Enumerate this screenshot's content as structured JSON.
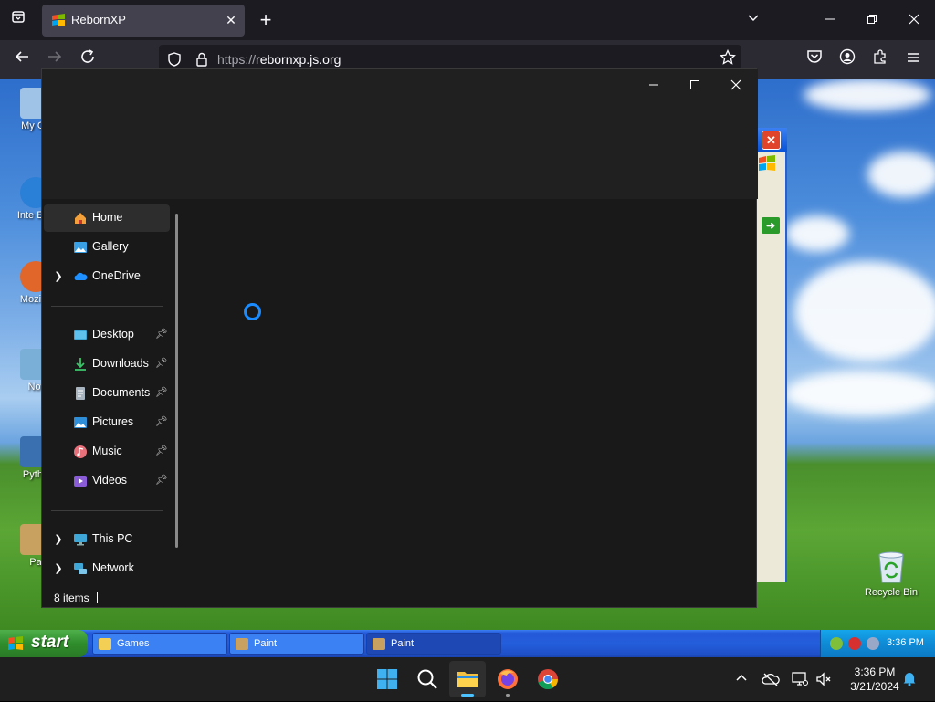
{
  "browser": {
    "tab_title": "RebornXP",
    "url_scheme": "https://",
    "url_host": "rebornxp.js.org"
  },
  "desktop": {
    "icons": [
      "My Co",
      "Inte Exp",
      "Mozilla",
      "Not",
      "Pytho",
      "Pa"
    ],
    "recycle_bin": "Recycle Bin"
  },
  "explorer": {
    "nav": {
      "home": "Home",
      "gallery": "Gallery",
      "onedrive": "OneDrive",
      "desktop": "Desktop",
      "downloads": "Downloads",
      "documents": "Documents",
      "pictures": "Pictures",
      "music": "Music",
      "videos": "Videos",
      "this_pc": "This PC",
      "network": "Network"
    },
    "status": "8 items"
  },
  "xp_taskbar": {
    "start_label": "start",
    "tasks": [
      "Games",
      "Paint",
      "Paint"
    ],
    "clock": "3:36 PM"
  },
  "w11_taskbar": {
    "time": "3:36 PM",
    "date": "3/21/2024"
  },
  "colors": {
    "accent": "#1a8cff",
    "explorer_bg": "#191919",
    "xp_taskbar": "#245edb"
  }
}
